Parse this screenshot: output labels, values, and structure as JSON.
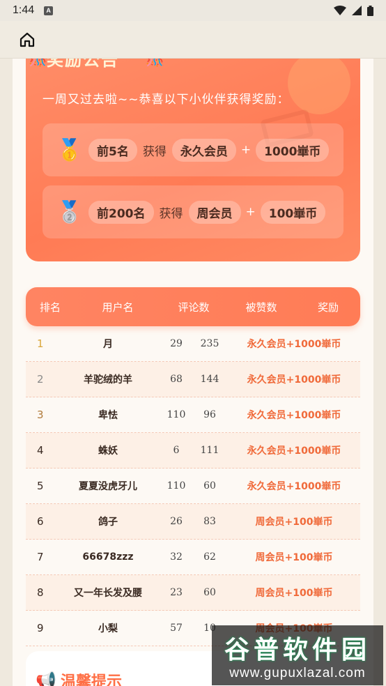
{
  "status_bar": {
    "time": "1:44",
    "a_badge": "A"
  },
  "app_bar": {
    "home_icon": "home-icon"
  },
  "announcement": {
    "title": "奖励公告",
    "subtitle": "一周又过去啦~~恭喜以下小伙伴获得奖励：",
    "awards": [
      {
        "medal": "🥇",
        "range": "前5名",
        "get": "获得",
        "item1": "永久会员",
        "plus": "+",
        "item2": "1000崋币"
      },
      {
        "medal": "🥈",
        "range": "前200名",
        "get": "获得",
        "item1": "周会员",
        "plus": "+",
        "item2": "100崋币"
      }
    ]
  },
  "leaderboard": {
    "headers": {
      "rank": "排名",
      "user": "用户名",
      "comments": "评论数",
      "likes": "被赞数",
      "reward": "奖励"
    },
    "rows": [
      {
        "rank": "1",
        "user": "月",
        "comments": "29",
        "likes": "235",
        "reward": "永久会员+1000崋币"
      },
      {
        "rank": "2",
        "user": "羊驼绒的羊",
        "comments": "68",
        "likes": "144",
        "reward": "永久会员+1000崋币"
      },
      {
        "rank": "3",
        "user": "卑怯",
        "comments": "110",
        "likes": "96",
        "reward": "永久会员+1000崋币"
      },
      {
        "rank": "4",
        "user": "蛛妖",
        "comments": "6",
        "likes": "111",
        "reward": "永久会员+1000崋币"
      },
      {
        "rank": "5",
        "user": "夏夏没虎牙儿",
        "comments": "110",
        "likes": "60",
        "reward": "永久会员+1000崋币"
      },
      {
        "rank": "6",
        "user": "鸽子",
        "comments": "26",
        "likes": "83",
        "reward": "周会员+100崋币"
      },
      {
        "rank": "7",
        "user": "66678zzz",
        "comments": "32",
        "likes": "62",
        "reward": "周会员+100崋币"
      },
      {
        "rank": "8",
        "user": "又一年长发及腰",
        "comments": "23",
        "likes": "60",
        "reward": "周会员+100崋币"
      },
      {
        "rank": "9",
        "user": "小梨",
        "comments": "57",
        "likes": "10",
        "reward": "周会员+100崋币"
      }
    ]
  },
  "tips": {
    "title": "温馨提示"
  },
  "watermark": {
    "main": "谷普软件园",
    "url": "www.gupuxlazal.com"
  },
  "colors": {
    "accent": "#ff7b55",
    "reward_text": "#f06a3a",
    "page_bg": "#efe9de"
  }
}
